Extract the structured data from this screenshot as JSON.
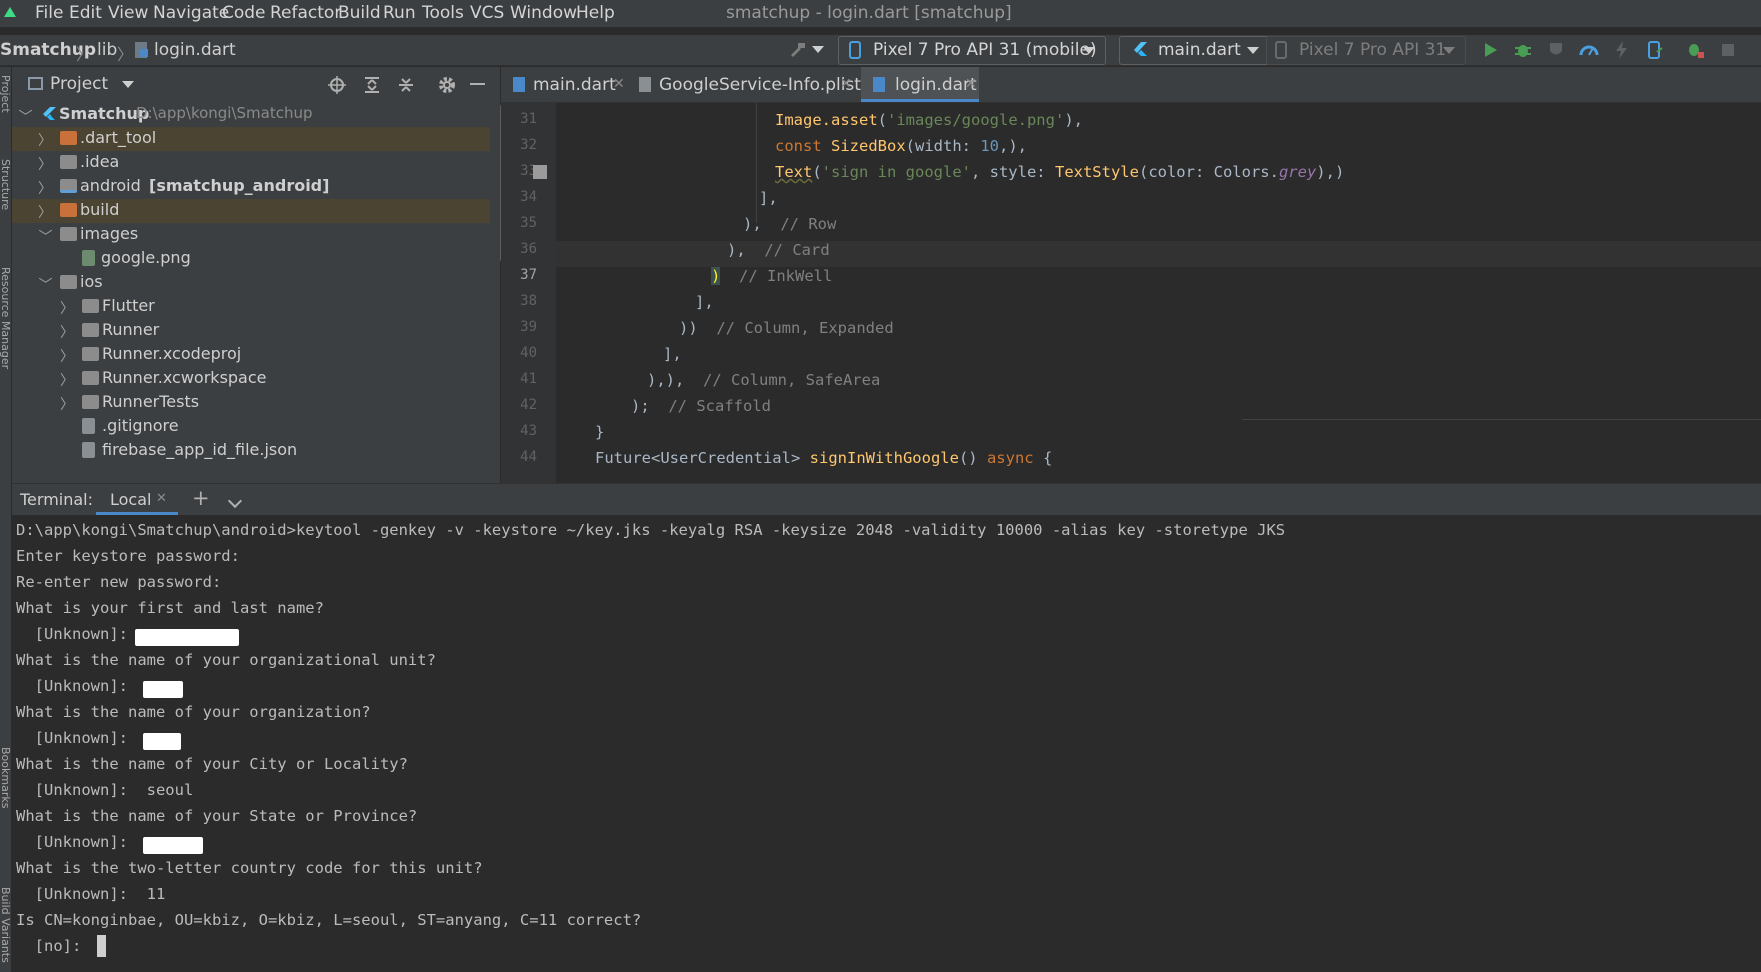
{
  "menu": {
    "items": [
      "File",
      "Edit",
      "View",
      "Navigate",
      "Code",
      "Refactor",
      "Build",
      "Run",
      "Tools",
      "VCS",
      "Window",
      "Help"
    ],
    "window_title": "smatchup - login.dart [smatchup]"
  },
  "navbar": {
    "breadcrumb": [
      "Smatchup",
      "lib",
      "login.dart"
    ],
    "device": "Pixel 7 Pro API 31 (mobile)",
    "run_config": "main.dart",
    "secondary_device": "Pixel 7 Pro API 31"
  },
  "left_strip": {
    "labels": [
      "Project",
      "Structure",
      "Resource Manager",
      "Bookmarks",
      "Build Variants"
    ]
  },
  "project": {
    "title": "Project",
    "tree": [
      {
        "name": "Smatchup",
        "path": "D:\\app\\kongi\\Smatchup",
        "expanded": true,
        "highlight": false,
        "icon": "flutter-icon"
      },
      {
        "name": ".dart_tool",
        "expanded": false,
        "highlight": true,
        "icon": "folder-orange-icon"
      },
      {
        "name": ".idea",
        "expanded": false,
        "highlight": false,
        "icon": "folder-icon"
      },
      {
        "name": "android",
        "module": "[smatchup_android]",
        "expanded": false,
        "highlight": false,
        "icon": "module-folder-icon"
      },
      {
        "name": "build",
        "expanded": false,
        "highlight": true,
        "icon": "folder-orange-icon"
      },
      {
        "name": "images",
        "expanded": true,
        "highlight": false,
        "icon": "folder-icon"
      },
      {
        "name": "google.png",
        "highlight": false,
        "icon": "image-file-icon"
      },
      {
        "name": "ios",
        "expanded": true,
        "highlight": false,
        "icon": "folder-icon"
      },
      {
        "name": "Flutter",
        "expanded": false,
        "highlight": false,
        "icon": "folder-icon"
      },
      {
        "name": "Runner",
        "expanded": false,
        "highlight": false,
        "icon": "folder-icon"
      },
      {
        "name": "Runner.xcodeproj",
        "expanded": false,
        "highlight": false,
        "icon": "folder-icon"
      },
      {
        "name": "Runner.xcworkspace",
        "expanded": false,
        "highlight": false,
        "icon": "folder-icon"
      },
      {
        "name": "RunnerTests",
        "expanded": false,
        "highlight": false,
        "icon": "folder-icon"
      },
      {
        "name": ".gitignore",
        "highlight": false,
        "icon": "gitignore-file-icon"
      },
      {
        "name": "firebase_app_id_file.json",
        "highlight": false,
        "icon": "json-file-icon"
      }
    ]
  },
  "editor": {
    "tabs": [
      {
        "label": "main.dart",
        "active": false
      },
      {
        "label": "GoogleService-Info.plist",
        "active": false
      },
      {
        "label": "login.dart",
        "active": true
      }
    ],
    "line_numbers": [
      "31",
      "32",
      "33",
      "34",
      "35",
      "36",
      "37",
      "38",
      "39",
      "40",
      "41",
      "42",
      "43",
      "44"
    ],
    "caret_line": "37",
    "code": {
      "l31_fn": "Image.asset",
      "l31_str": "'images/google.png'",
      "l32_kw": "const",
      "l32_fn": "SizedBox",
      "l32_rest": "(width: ",
      "l32_num": "10",
      "l33_fn": "Text",
      "l33_str": "'sign in google'",
      "l33_mid": ", style: ",
      "l33_fn2": "TextStyle",
      "l33_mid2": "(color: Colors.",
      "l33_grey": "grey",
      "l34": "],",
      "l35_cm": "// Row",
      "l36_cm": "// Card",
      "l37_cm": "// InkWell",
      "l38": "],",
      "l39": "))",
      "l39_cm": "// Column, Expanded",
      "l40": "],",
      "l41": "),),",
      "l41_cm": "// Column, SafeArea",
      "l42": ");",
      "l42_cm": "// Scaffold",
      "l43": "}",
      "l44_type": "Future<UserCredential>",
      "l44_fn": "signInWithGoogle",
      "l44_kw": "async"
    }
  },
  "terminal": {
    "label": "Terminal:",
    "tab": "Local",
    "lines": [
      "D:\\app\\kongi\\Smatchup\\android>keytool -genkey -v -keystore ~/key.jks -keyalg RSA -keysize 2048 -validity 10000 -alias key -storetype JKS",
      "Enter keystore password:",
      "Re-enter new password:",
      "What is your first and last name?",
      "  [Unknown]:",
      "What is the name of your organizational unit?",
      "  [Unknown]:",
      "What is the name of your organization?",
      "  [Unknown]:",
      "What is the name of your City or Locality?",
      "  [Unknown]:  seoul",
      "What is the name of your State or Province?",
      "  [Unknown]:",
      "What is the two-letter country code for this unit?",
      "  [Unknown]:  11",
      "Is CN=konginbae, OU=kbiz, O=kbiz, L=seoul, ST=anyang, C=11 correct?",
      "  [no]:"
    ]
  }
}
